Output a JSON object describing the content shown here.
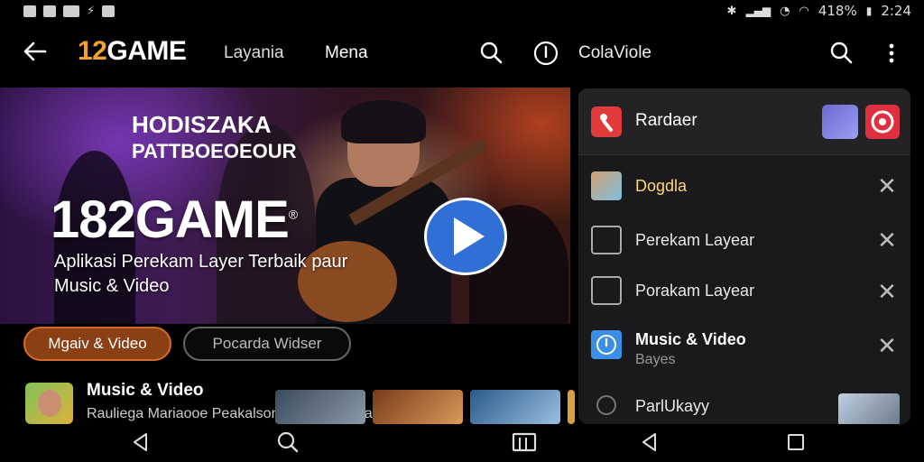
{
  "status_bar": {
    "left_text": "",
    "battery": "418%",
    "time": "2:24"
  },
  "topbar": {
    "brand_prefix": "12",
    "brand_suffix": "GAME",
    "nav": [
      "Layania",
      "Mena"
    ],
    "right_title": "ColaViole"
  },
  "hero": {
    "tag_line_1": "HODISZAKA",
    "tag_line_2": "PATTBOEOEOUR",
    "title": "182GAME",
    "title_mark": "®",
    "subtitle": "Aplikasi Perekam Layer Terbaik paur Music & Video"
  },
  "pills": {
    "primary": "Mgaiv & Video",
    "secondary": "Pocarda Widser"
  },
  "featured": {
    "title": "Music & Video",
    "subtitle": "Rauliega Mariaooe Peakalson & Palkaro Kranote"
  },
  "panel": {
    "header_label": "Rardaer",
    "rows": [
      {
        "label": "Dogdla"
      },
      {
        "label": "Perekam Layear"
      },
      {
        "label": "Porakam Layear"
      },
      {
        "label": "Music & Video",
        "sub": "Bayes"
      },
      {
        "label": "ParlUkayy"
      }
    ]
  },
  "colors": {
    "brand_orange": "#f5a12a",
    "primary_pill": "#8a3f15",
    "play_blue": "#2f6fd6",
    "panel_bg": "#1a1a1c"
  }
}
